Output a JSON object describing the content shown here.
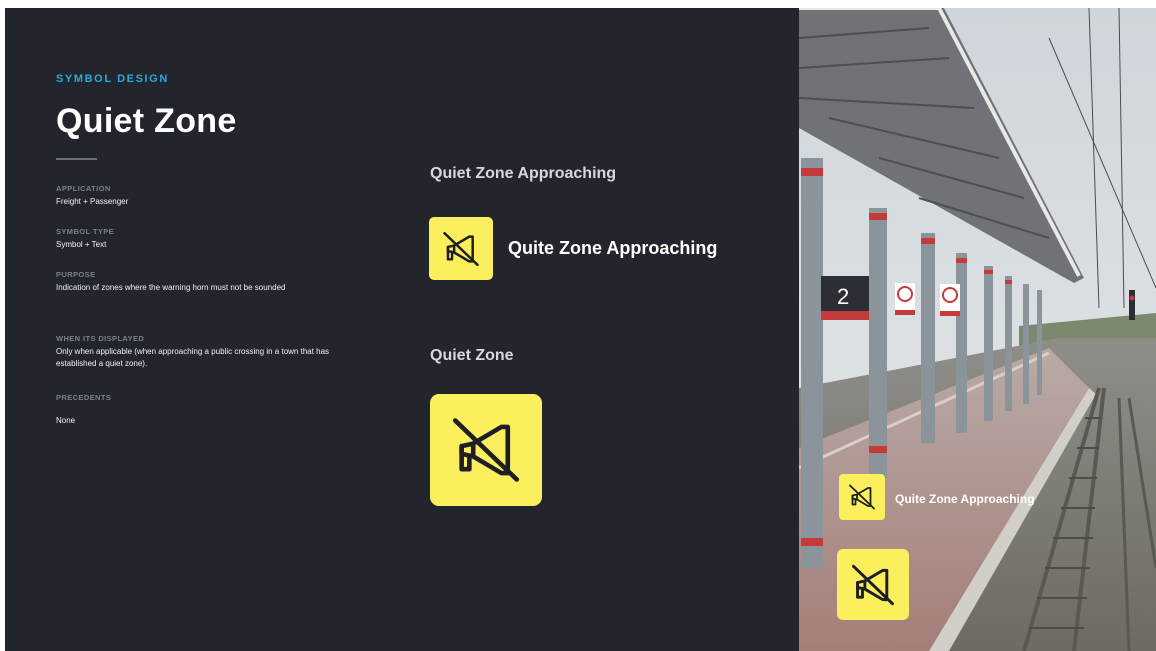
{
  "header": {
    "eyebrow": "SYMBOL DESIGN",
    "title": "Quiet Zone"
  },
  "details": [
    {
      "label": "APPLICATION",
      "value": "Freight + Passenger"
    },
    {
      "label": "SYMBOL TYPE",
      "value": "Symbol + Text"
    },
    {
      "label": "PURPOSE",
      "value": "Indication of zones where the warning horn must not be sounded"
    },
    {
      "label": "WHEN ITS DISPLAYED",
      "value": "Only when applicable (when approaching a public crossing in a town that has established a quiet zone)."
    },
    {
      "label": "PRECEDENTS",
      "value": "None"
    }
  ],
  "examples": {
    "approaching_heading": "Quiet Zone Approaching",
    "approaching_sign_text": "Quite Zone Approaching",
    "zone_heading": "Quiet Zone"
  },
  "photo": {
    "platform_number": "2",
    "overlay_sign_text": "Quite Zone Approaching"
  },
  "colors": {
    "background": "#22262c",
    "accent": "#29a9d8",
    "sign_yellow": "#fbef5d"
  },
  "icons": [
    "no-horn-icon"
  ]
}
